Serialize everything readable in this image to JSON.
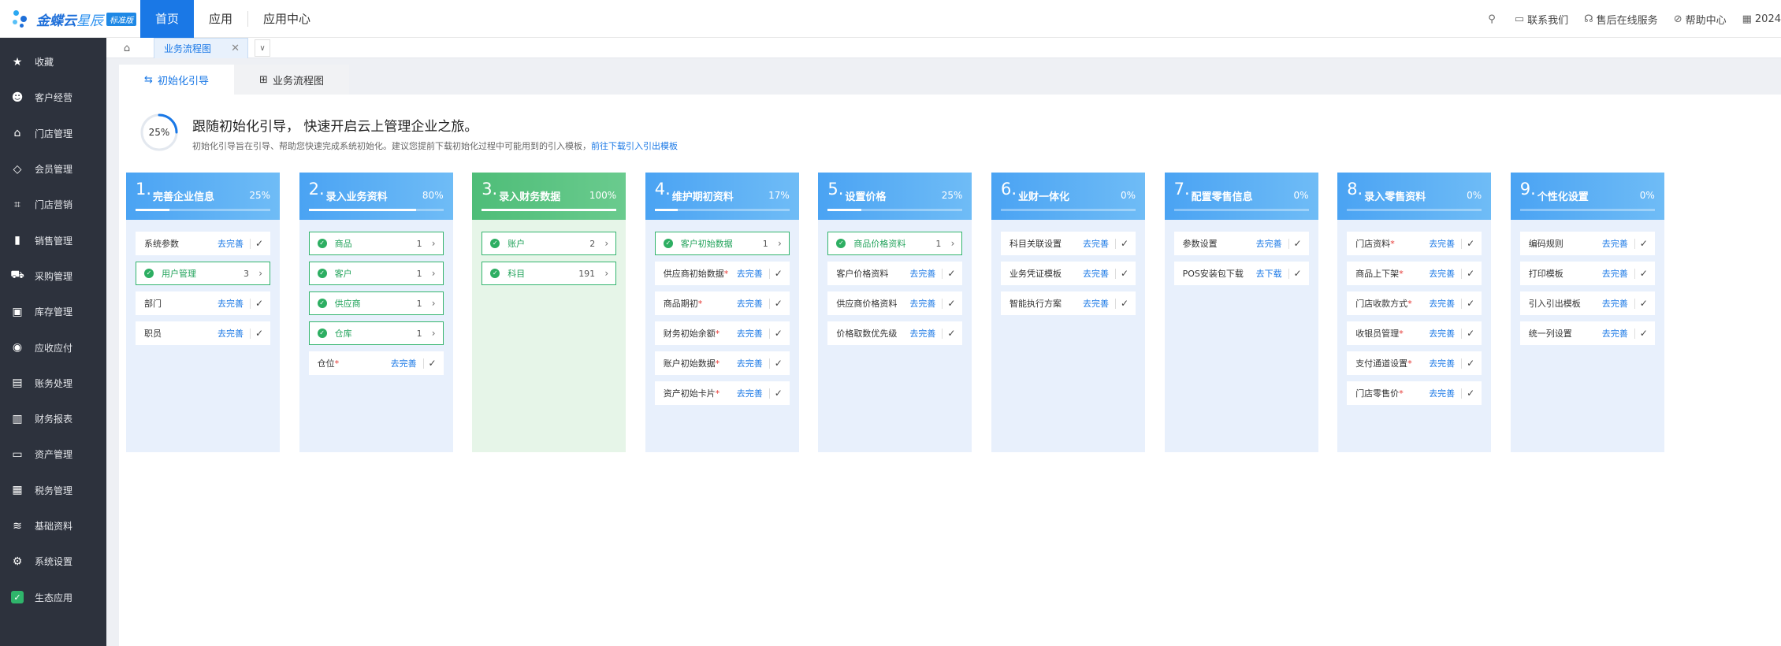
{
  "app": {
    "brand": "金蝶云",
    "brand_sub": "星辰",
    "edition": "标准版"
  },
  "topnav": {
    "items": [
      "首页",
      "应用",
      "应用中心"
    ],
    "active_index": 0
  },
  "topright": {
    "contact": "联系我们",
    "service": "售后在线服务",
    "help": "帮助中心",
    "date_fragment": "2024"
  },
  "sidebar": {
    "items": [
      {
        "label": "收藏",
        "icon": "star-icon"
      },
      {
        "label": "客户经营",
        "icon": "customer-icon"
      },
      {
        "label": "门店管理",
        "icon": "store-icon"
      },
      {
        "label": "会员管理",
        "icon": "member-icon"
      },
      {
        "label": "门店营销",
        "icon": "tag-icon"
      },
      {
        "label": "销售管理",
        "icon": "bar-chart-icon"
      },
      {
        "label": "采购管理",
        "icon": "cart-icon"
      },
      {
        "label": "库存管理",
        "icon": "box-icon"
      },
      {
        "label": "应收应付",
        "icon": "money-icon"
      },
      {
        "label": "账务处理",
        "icon": "ledger-icon"
      },
      {
        "label": "财务报表",
        "icon": "report-icon"
      },
      {
        "label": "资产管理",
        "icon": "asset-icon"
      },
      {
        "label": "税务管理",
        "icon": "tax-icon"
      },
      {
        "label": "基础资料",
        "icon": "layers-icon"
      },
      {
        "label": "系统设置",
        "icon": "gear-icon"
      },
      {
        "label": "生态应用",
        "icon": "eco-app-icon"
      }
    ]
  },
  "tabs": {
    "open_tab": "业务流程图"
  },
  "subtabs": {
    "guide": "初始化引导",
    "flow": "业务流程图"
  },
  "guide": {
    "progress_label": "25%",
    "progress_value": 0.25,
    "headline": "跟随初始化引导， 快速开启云上管理企业之旅。",
    "subline": "初始化引导旨在引导、帮助您快速完成系统初始化。建议您提前下载初始化过程中可能用到的引入模板，",
    "sublink": "前往下载引入引出模板"
  },
  "colors": {
    "primary": "#1a78e6",
    "sidebar": "#2d323d",
    "success": "#2dae62",
    "required": "#e53935"
  },
  "steps": [
    {
      "num": "1.",
      "title": "完善企业信息",
      "pct": "25%",
      "progress": 0.25,
      "done": false,
      "items": [
        {
          "label": "系统参数",
          "action": "去完善"
        },
        {
          "label": "用户管理",
          "ok": true,
          "count": "3"
        },
        {
          "label": "部门",
          "action": "去完善"
        },
        {
          "label": "职员",
          "action": "去完善"
        }
      ]
    },
    {
      "num": "2.",
      "title": "录入业务资料",
      "pct": "80%",
      "progress": 0.8,
      "done": false,
      "items": [
        {
          "label": "商品",
          "ok": true,
          "count": "1"
        },
        {
          "label": "客户",
          "ok": true,
          "count": "1"
        },
        {
          "label": "供应商",
          "ok": true,
          "count": "1"
        },
        {
          "label": "仓库",
          "ok": true,
          "count": "1"
        },
        {
          "label": "仓位",
          "req": "*",
          "action": "去完善"
        }
      ]
    },
    {
      "num": "3.",
      "title": "录入财务数据",
      "pct": "100%",
      "progress": 1.0,
      "done": true,
      "items": [
        {
          "label": "账户",
          "ok": true,
          "count": "2"
        },
        {
          "label": "科目",
          "ok": true,
          "count": "191"
        }
      ]
    },
    {
      "num": "4.",
      "title": "维护期初资料",
      "pct": "17%",
      "progress": 0.17,
      "done": false,
      "items": [
        {
          "label": "客户初始数据",
          "ok": true,
          "count": "1"
        },
        {
          "label": "供应商初始数据",
          "req": "*",
          "action": "去完善"
        },
        {
          "label": "商品期初",
          "req": "*",
          "action": "去完善"
        },
        {
          "label": "财务初始余额",
          "req": "*",
          "action": "去完善"
        },
        {
          "label": "账户初始数据",
          "req": "*",
          "action": "去完善"
        },
        {
          "label": "资产初始卡片",
          "req": "*",
          "action": "去完善"
        }
      ]
    },
    {
      "num": "5.",
      "title": "设置价格",
      "pct": "25%",
      "progress": 0.25,
      "done": false,
      "items": [
        {
          "label": "商品价格资料",
          "ok": true,
          "count": "1"
        },
        {
          "label": "客户价格资料",
          "action": "去完善"
        },
        {
          "label": "供应商价格资料",
          "action": "去完善"
        },
        {
          "label": "价格取数优先级",
          "action": "去完善"
        }
      ]
    },
    {
      "num": "6.",
      "title": "业财一体化",
      "pct": "0%",
      "progress": 0.0,
      "done": false,
      "items": [
        {
          "label": "科目关联设置",
          "action": "去完善"
        },
        {
          "label": "业务凭证模板",
          "action": "去完善"
        },
        {
          "label": "智能执行方案",
          "action": "去完善"
        }
      ]
    },
    {
      "num": "7.",
      "title": "配置零售信息",
      "pct": "0%",
      "progress": 0.0,
      "done": false,
      "items": [
        {
          "label": "参数设置",
          "action": "去完善"
        },
        {
          "label": "POS安装包下载",
          "action": "去下载"
        }
      ]
    },
    {
      "num": "8.",
      "title": "录入零售资料",
      "pct": "0%",
      "progress": 0.0,
      "done": false,
      "items": [
        {
          "label": "门店资料",
          "req": "*",
          "action": "去完善"
        },
        {
          "label": "商品上下架",
          "req": "*",
          "action": "去完善"
        },
        {
          "label": "门店收款方式",
          "req": "*",
          "action": "去完善"
        },
        {
          "label": "收银员管理",
          "req": "*",
          "action": "去完善"
        },
        {
          "label": "支付通道设置",
          "req": "*",
          "action": "去完善"
        },
        {
          "label": "门店零售价",
          "req": "*",
          "action": "去完善"
        }
      ]
    },
    {
      "num": "9.",
      "title": "个性化设置",
      "pct": "0%",
      "progress": 0.0,
      "done": false,
      "items": [
        {
          "label": "编码规则",
          "action": "去完善"
        },
        {
          "label": "打印模板",
          "action": "去完善"
        },
        {
          "label": "引入引出模板",
          "action": "去完善"
        },
        {
          "label": "统一列设置",
          "action": "去完善"
        }
      ]
    }
  ]
}
